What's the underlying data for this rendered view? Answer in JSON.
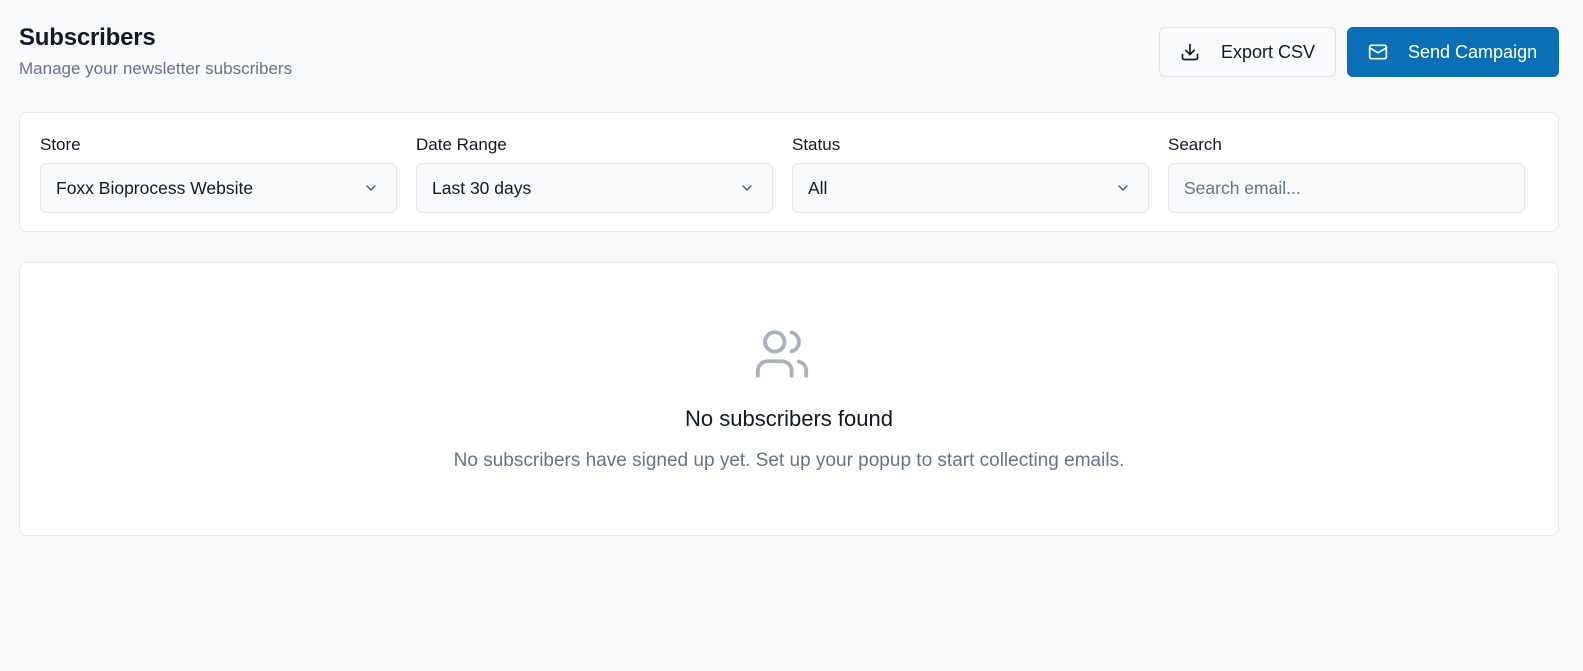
{
  "header": {
    "title": "Subscribers",
    "subtitle": "Manage your newsletter subscribers",
    "export_label": "Export CSV",
    "send_label": "Send Campaign"
  },
  "filters": {
    "store": {
      "label": "Store",
      "value": "Foxx Bioprocess Website"
    },
    "date_range": {
      "label": "Date Range",
      "value": "Last 30 days"
    },
    "status": {
      "label": "Status",
      "value": "All"
    },
    "search": {
      "label": "Search",
      "placeholder": "Search email..."
    }
  },
  "empty_state": {
    "icon": "users-icon",
    "title": "No subscribers found",
    "description": "No subscribers have signed up yet. Set up your popup to start collecting emails."
  },
  "colors": {
    "primary": "#0a6fb5",
    "background": "#f8f9fb",
    "muted_text": "#64748b",
    "icon_muted": "#a9b1be"
  }
}
